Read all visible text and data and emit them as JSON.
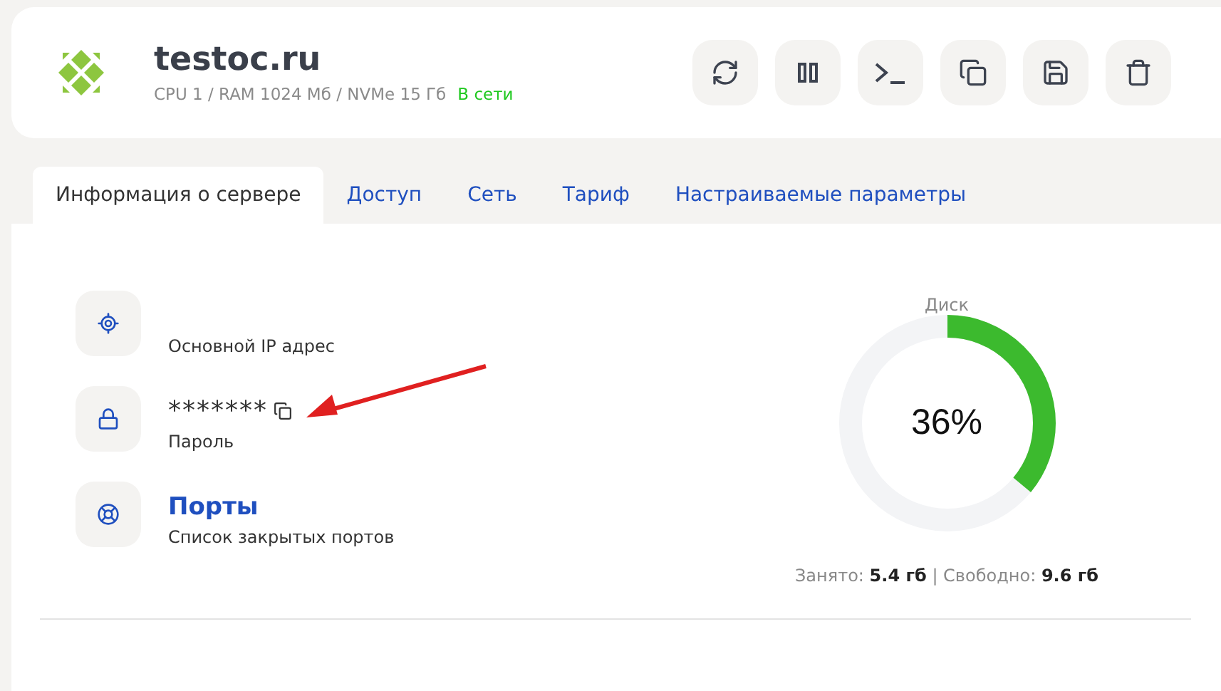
{
  "header": {
    "title": "testoc.ru",
    "specs": "CPU 1 / RAM 1024 Мб / NVMe 15 Гб",
    "status": {
      "text": "В сети",
      "online": true
    }
  },
  "toolbar": [
    {
      "kind": "refresh"
    },
    {
      "kind": "pause"
    },
    {
      "kind": "terminal"
    },
    {
      "kind": "copy"
    },
    {
      "kind": "save"
    },
    {
      "kind": "delete"
    }
  ],
  "tabs": [
    {
      "label": "Информация о сервере",
      "selected": true
    },
    {
      "label": "Доступ",
      "selected": false
    },
    {
      "label": "Сеть",
      "selected": false
    },
    {
      "label": "Тариф",
      "selected": false
    },
    {
      "label": "Настраиваемые параметры",
      "selected": false
    }
  ],
  "info": [
    {
      "kind": "ip",
      "label": "Основной IP адрес"
    },
    {
      "kind": "password",
      "value": "*******",
      "label": "Пароль"
    },
    {
      "kind": "ports",
      "link": "Порты",
      "label": "Список закрытых портов"
    }
  ],
  "disk": {
    "title": "Диск",
    "level": 0.36,
    "reading": "36%",
    "summary": "Занято: **5.4 гб** | Свободно: **9.6 гб**"
  }
}
